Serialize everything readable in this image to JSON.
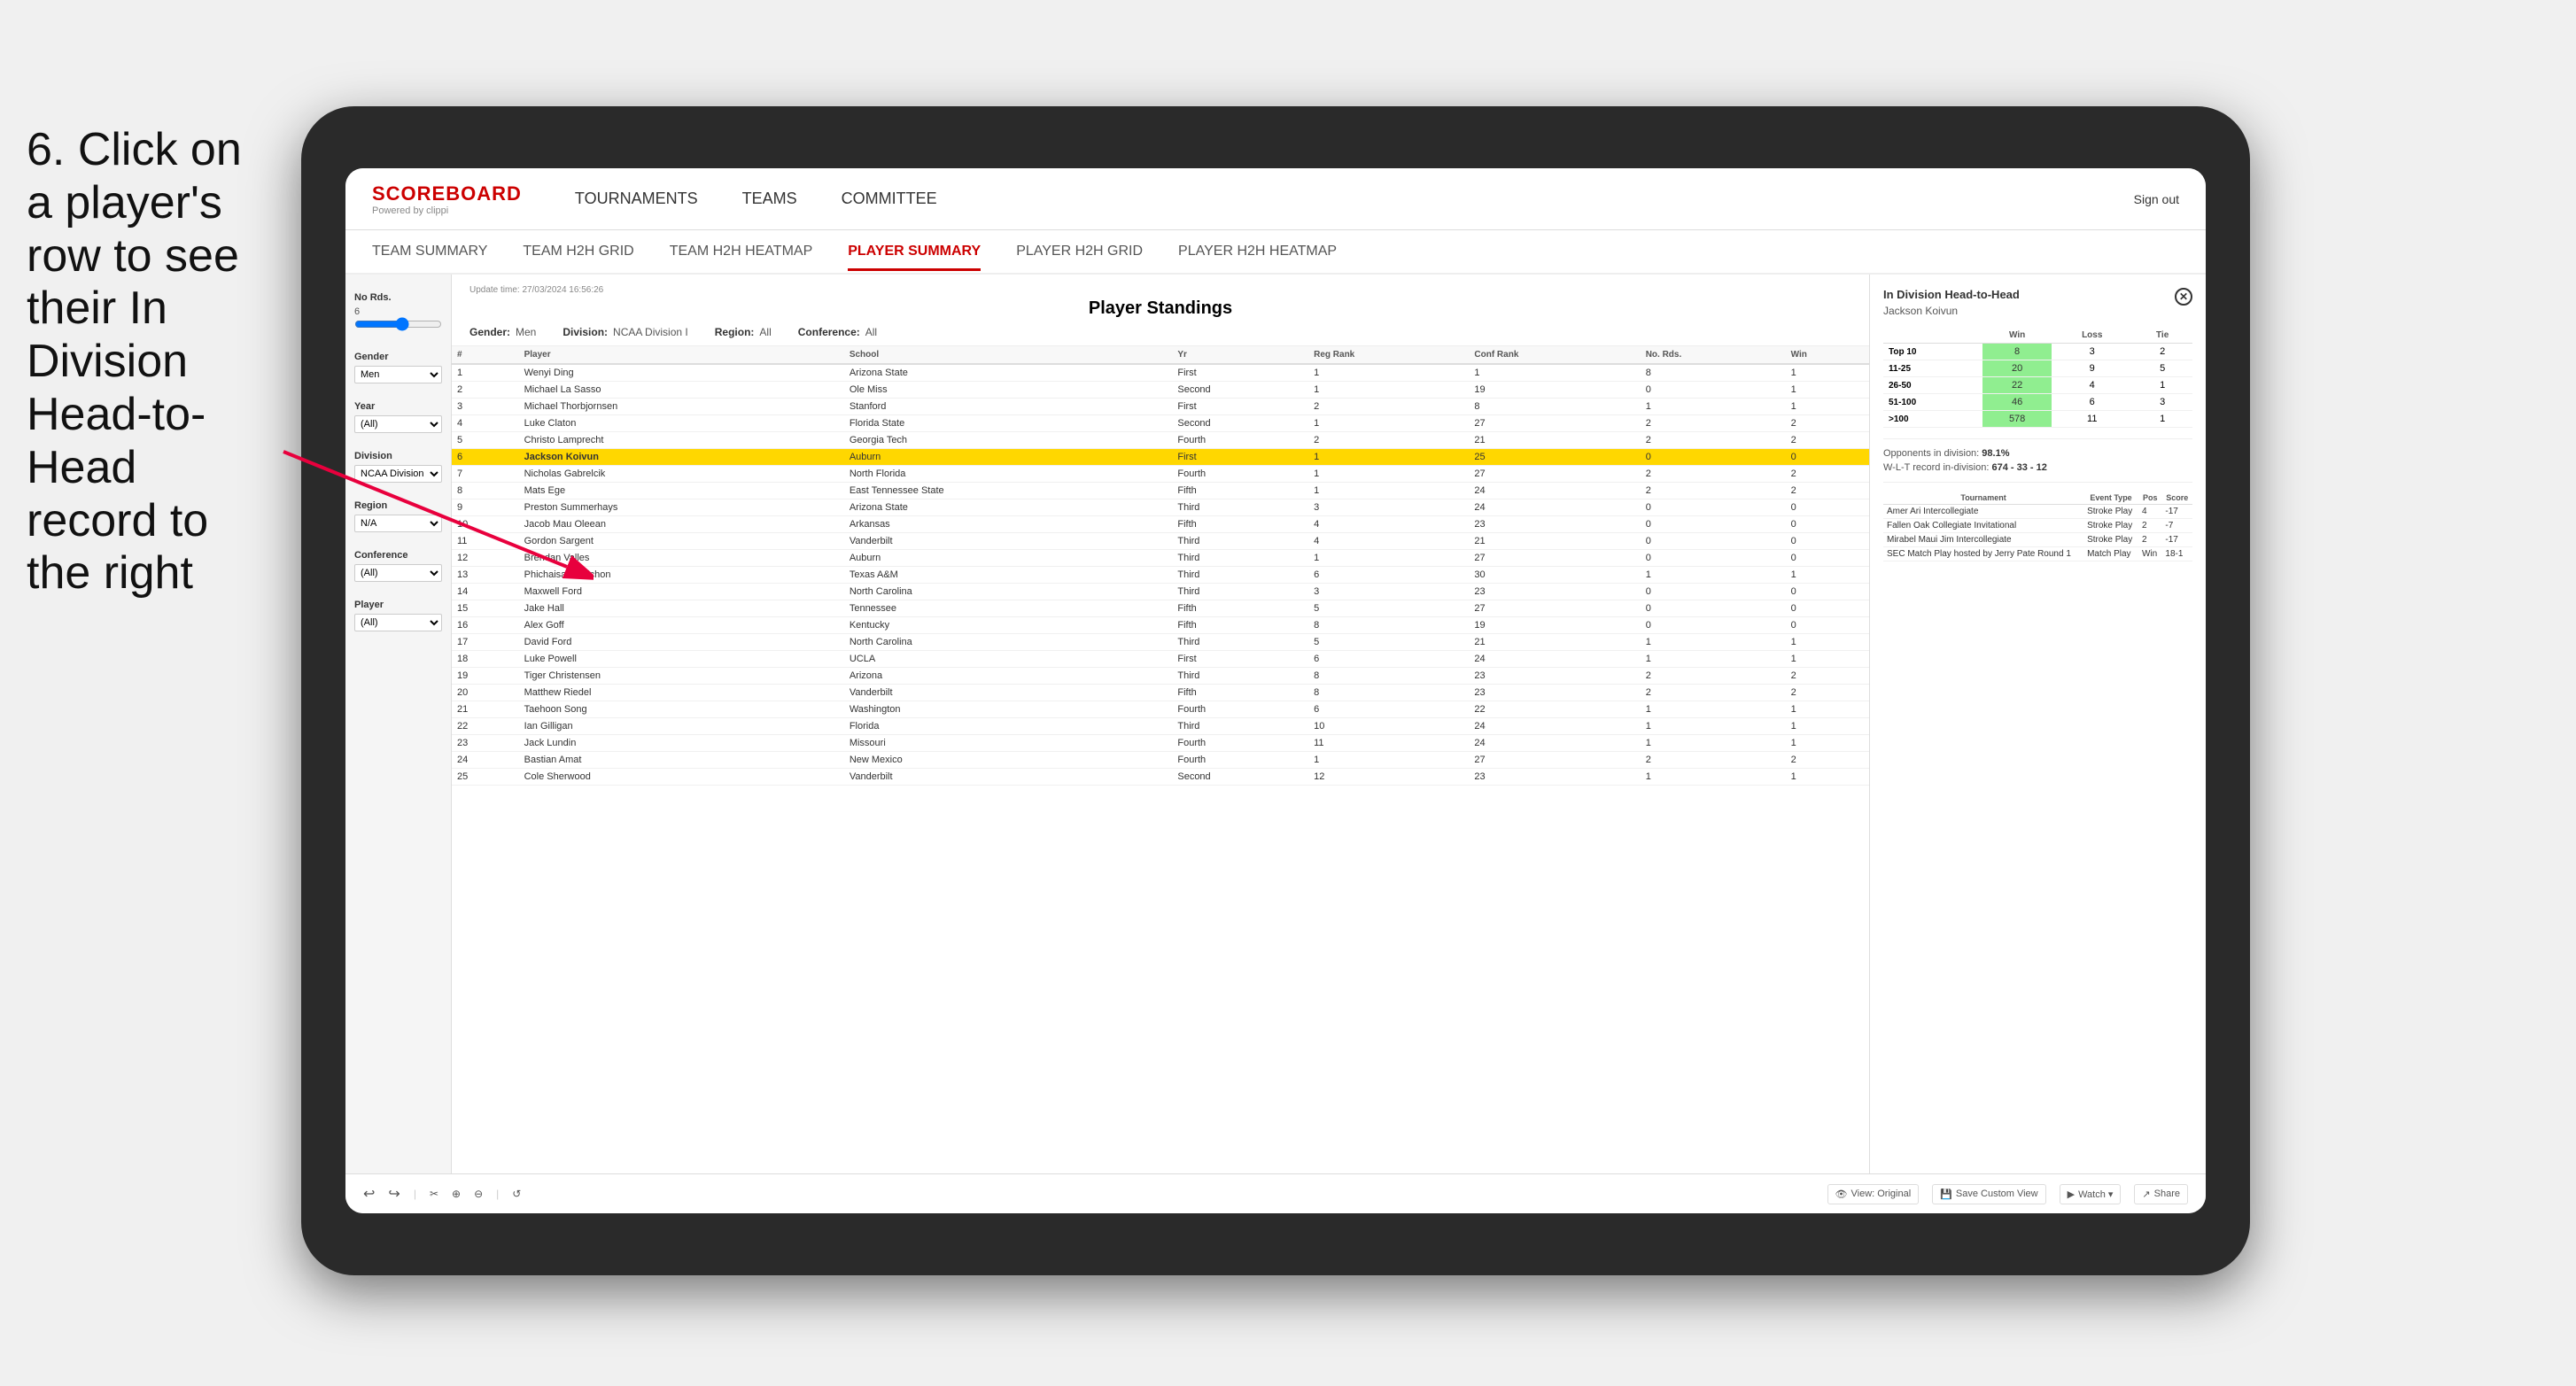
{
  "instruction": {
    "step": "6.",
    "text": "Click on a player's row to see their In Division Head-to-Head record to the right"
  },
  "navbar": {
    "logo": "SCOREBOARD",
    "logo_sub": "Powered by clippi",
    "nav_items": [
      "TOURNAMENTS",
      "TEAMS",
      "COMMITTEE"
    ],
    "sign_out": "Sign out"
  },
  "subnav": {
    "items": [
      "TEAM SUMMARY",
      "TEAM H2H GRID",
      "TEAM H2H HEATMAP",
      "PLAYER SUMMARY",
      "PLAYER H2H GRID",
      "PLAYER H2H HEATMAP"
    ]
  },
  "filters": {
    "no_rds": {
      "label": "No Rds.",
      "value": "6"
    },
    "gender": {
      "label": "Gender",
      "value": "Men"
    },
    "year": {
      "label": "Year",
      "value": "(All)"
    },
    "division": {
      "label": "Division",
      "value": "NCAA Division I"
    },
    "region": {
      "label": "Region",
      "value": "N/A"
    },
    "conference": {
      "label": "Conference",
      "value": "(All)"
    },
    "player": {
      "label": "Player",
      "value": "(All)"
    }
  },
  "standings": {
    "update_time_label": "Update time:",
    "update_time": "27/03/2024 16:56:26",
    "title": "Player Standings",
    "gender_label": "Gender:",
    "gender": "Men",
    "division_label": "Division:",
    "division": "NCAA Division I",
    "region_label": "Region:",
    "region": "All",
    "conference_label": "Conference:",
    "conference": "All",
    "columns": [
      "#",
      "Player",
      "School",
      "Yr",
      "Reg Rank",
      "Conf Rank",
      "No. Rds.",
      "Win"
    ],
    "rows": [
      {
        "rank": "1",
        "player": "Wenyi Ding",
        "school": "Arizona State",
        "yr": "First",
        "reg_rank": "1",
        "conf_rank": "1",
        "rds": "8",
        "win": "1"
      },
      {
        "rank": "2",
        "player": "Michael La Sasso",
        "school": "Ole Miss",
        "yr": "Second",
        "reg_rank": "1",
        "conf_rank": "19",
        "rds": "0",
        "win": "1"
      },
      {
        "rank": "3",
        "player": "Michael Thorbjornsen",
        "school": "Stanford",
        "yr": "First",
        "reg_rank": "2",
        "conf_rank": "8",
        "rds": "1",
        "win": "1"
      },
      {
        "rank": "4",
        "player": "Luke Claton",
        "school": "Florida State",
        "yr": "Second",
        "reg_rank": "1",
        "conf_rank": "27",
        "rds": "2",
        "win": "2"
      },
      {
        "rank": "5",
        "player": "Christo Lamprecht",
        "school": "Georgia Tech",
        "yr": "Fourth",
        "reg_rank": "2",
        "conf_rank": "21",
        "rds": "2",
        "win": "2"
      },
      {
        "rank": "6",
        "player": "Jackson Koivun",
        "school": "Auburn",
        "yr": "First",
        "reg_rank": "1",
        "conf_rank": "25",
        "rds": "0",
        "win": "0",
        "selected": true
      },
      {
        "rank": "7",
        "player": "Nicholas Gabrelcik",
        "school": "North Florida",
        "yr": "Fourth",
        "reg_rank": "1",
        "conf_rank": "27",
        "rds": "2",
        "win": "2"
      },
      {
        "rank": "8",
        "player": "Mats Ege",
        "school": "East Tennessee State",
        "yr": "Fifth",
        "reg_rank": "1",
        "conf_rank": "24",
        "rds": "2",
        "win": "2"
      },
      {
        "rank": "9",
        "player": "Preston Summerhays",
        "school": "Arizona State",
        "yr": "Third",
        "reg_rank": "3",
        "conf_rank": "24",
        "rds": "0",
        "win": "0"
      },
      {
        "rank": "10",
        "player": "Jacob Mau Oleean",
        "school": "Arkansas",
        "yr": "Fifth",
        "reg_rank": "4",
        "conf_rank": "23",
        "rds": "0",
        "win": "0"
      },
      {
        "rank": "11",
        "player": "Gordon Sargent",
        "school": "Vanderbilt",
        "yr": "Third",
        "reg_rank": "4",
        "conf_rank": "21",
        "rds": "0",
        "win": "0"
      },
      {
        "rank": "12",
        "player": "Brendan Valles",
        "school": "Auburn",
        "yr": "Third",
        "reg_rank": "1",
        "conf_rank": "27",
        "rds": "0",
        "win": "0"
      },
      {
        "rank": "13",
        "player": "Phichaisak Malchon",
        "school": "Texas A&M",
        "yr": "Third",
        "reg_rank": "6",
        "conf_rank": "30",
        "rds": "1",
        "win": "1"
      },
      {
        "rank": "14",
        "player": "Maxwell Ford",
        "school": "North Carolina",
        "yr": "Third",
        "reg_rank": "3",
        "conf_rank": "23",
        "rds": "0",
        "win": "0"
      },
      {
        "rank": "15",
        "player": "Jake Hall",
        "school": "Tennessee",
        "yr": "Fifth",
        "reg_rank": "5",
        "conf_rank": "27",
        "rds": "0",
        "win": "0"
      },
      {
        "rank": "16",
        "player": "Alex Goff",
        "school": "Kentucky",
        "yr": "Fifth",
        "reg_rank": "8",
        "conf_rank": "19",
        "rds": "0",
        "win": "0"
      },
      {
        "rank": "17",
        "player": "David Ford",
        "school": "North Carolina",
        "yr": "Third",
        "reg_rank": "5",
        "conf_rank": "21",
        "rds": "1",
        "win": "1"
      },
      {
        "rank": "18",
        "player": "Luke Powell",
        "school": "UCLA",
        "yr": "First",
        "reg_rank": "6",
        "conf_rank": "24",
        "rds": "1",
        "win": "1"
      },
      {
        "rank": "19",
        "player": "Tiger Christensen",
        "school": "Arizona",
        "yr": "Third",
        "reg_rank": "8",
        "conf_rank": "23",
        "rds": "2",
        "win": "2"
      },
      {
        "rank": "20",
        "player": "Matthew Riedel",
        "school": "Vanderbilt",
        "yr": "Fifth",
        "reg_rank": "8",
        "conf_rank": "23",
        "rds": "2",
        "win": "2"
      },
      {
        "rank": "21",
        "player": "Taehoon Song",
        "school": "Washington",
        "yr": "Fourth",
        "reg_rank": "6",
        "conf_rank": "22",
        "rds": "1",
        "win": "1"
      },
      {
        "rank": "22",
        "player": "Ian Gilligan",
        "school": "Florida",
        "yr": "Third",
        "reg_rank": "10",
        "conf_rank": "24",
        "rds": "1",
        "win": "1"
      },
      {
        "rank": "23",
        "player": "Jack Lundin",
        "school": "Missouri",
        "yr": "Fourth",
        "reg_rank": "11",
        "conf_rank": "24",
        "rds": "1",
        "win": "1"
      },
      {
        "rank": "24",
        "player": "Bastian Amat",
        "school": "New Mexico",
        "yr": "Fourth",
        "reg_rank": "1",
        "conf_rank": "27",
        "rds": "2",
        "win": "2"
      },
      {
        "rank": "25",
        "player": "Cole Sherwood",
        "school": "Vanderbilt",
        "yr": "Second",
        "reg_rank": "12",
        "conf_rank": "23",
        "rds": "1",
        "win": "1"
      }
    ]
  },
  "h2h": {
    "title": "In Division Head-to-Head",
    "player": "Jackson Koivun",
    "col_headers": [
      "",
      "Win",
      "Loss",
      "Tie"
    ],
    "rows": [
      {
        "label": "Top 10",
        "win": "8",
        "loss": "3",
        "tie": "2"
      },
      {
        "label": "11-25",
        "win": "20",
        "loss": "9",
        "tie": "5"
      },
      {
        "label": "26-50",
        "win": "22",
        "loss": "4",
        "tie": "1"
      },
      {
        "label": "51-100",
        "win": "46",
        "loss": "6",
        "tie": "3"
      },
      {
        "label": ">100",
        "win": "578",
        "loss": "11",
        "tie": "1"
      }
    ],
    "opponents_label": "Opponents in division:",
    "opponents_pct": "98.1%",
    "wlt_label": "W-L-T record in-division:",
    "wlt": "674 - 33 - 12",
    "tournament_columns": [
      "Tournament",
      "Event Type",
      "Pos",
      "Score"
    ],
    "tournaments": [
      {
        "name": "Amer Ari Intercollegiate",
        "type": "Stroke Play",
        "pos": "4",
        "score": "-17"
      },
      {
        "name": "Fallen Oak Collegiate Invitational",
        "type": "Stroke Play",
        "pos": "2",
        "score": "-7"
      },
      {
        "name": "Mirabel Maui Jim Intercollegiate",
        "type": "Stroke Play",
        "pos": "2",
        "score": "-17"
      },
      {
        "name": "SEC Match Play hosted by Jerry Pate Round 1",
        "type": "Match Play",
        "pos": "Win",
        "score": "18-1"
      }
    ]
  },
  "toolbar": {
    "buttons": [
      "◂",
      "▸",
      "↩",
      "⤲",
      "⤳",
      "⊕",
      "⊖",
      "◯",
      "↺"
    ],
    "view_original": "View: Original",
    "save_custom": "Save Custom View",
    "watch": "Watch ▾",
    "share": "Share"
  }
}
